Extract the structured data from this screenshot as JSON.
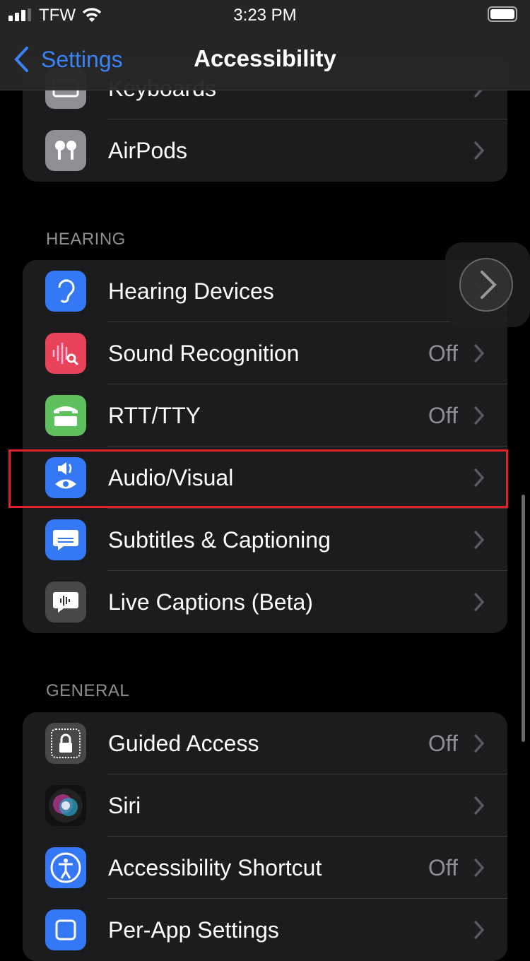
{
  "status": {
    "carrier": "TFW",
    "time": "3:23 PM"
  },
  "nav": {
    "back_label": "Settings",
    "title": "Accessibility"
  },
  "groups": [
    {
      "header": "",
      "items": [
        {
          "label": "Keyboards",
          "value": "",
          "icon": "keyboard-icon",
          "color": "#8e8e93"
        },
        {
          "label": "AirPods",
          "value": "",
          "icon": "airpods-icon",
          "color": "#8e8e93"
        }
      ]
    },
    {
      "header": "HEARING",
      "items": [
        {
          "label": "Hearing Devices",
          "value": "",
          "icon": "ear-icon",
          "color": "#3478f6"
        },
        {
          "label": "Sound Recognition",
          "value": "Off",
          "icon": "waveform-search-icon",
          "color": "#e9435a"
        },
        {
          "label": "RTT/TTY",
          "value": "Off",
          "icon": "tty-icon",
          "color": "#5fc15e"
        },
        {
          "label": "Audio/Visual",
          "value": "",
          "icon": "speaker-eye-icon",
          "color": "#3478f6"
        },
        {
          "label": "Subtitles & Captioning",
          "value": "",
          "icon": "caption-bubble-icon",
          "color": "#3478f6"
        },
        {
          "label": "Live Captions (Beta)",
          "value": "",
          "icon": "live-captions-icon",
          "color": "#48484a"
        }
      ]
    },
    {
      "header": "GENERAL",
      "items": [
        {
          "label": "Guided Access",
          "value": "Off",
          "icon": "lock-icon",
          "color": "#48484a"
        },
        {
          "label": "Siri",
          "value": "",
          "icon": "siri-icon",
          "color": "#111"
        },
        {
          "label": "Accessibility Shortcut",
          "value": "Off",
          "icon": "accessibility-icon",
          "color": "#3478f6"
        },
        {
          "label": "Per-App Settings",
          "value": "",
          "icon": "per-app-icon",
          "color": "#3478f6"
        }
      ]
    }
  ],
  "highlight_color": "#e3212b"
}
